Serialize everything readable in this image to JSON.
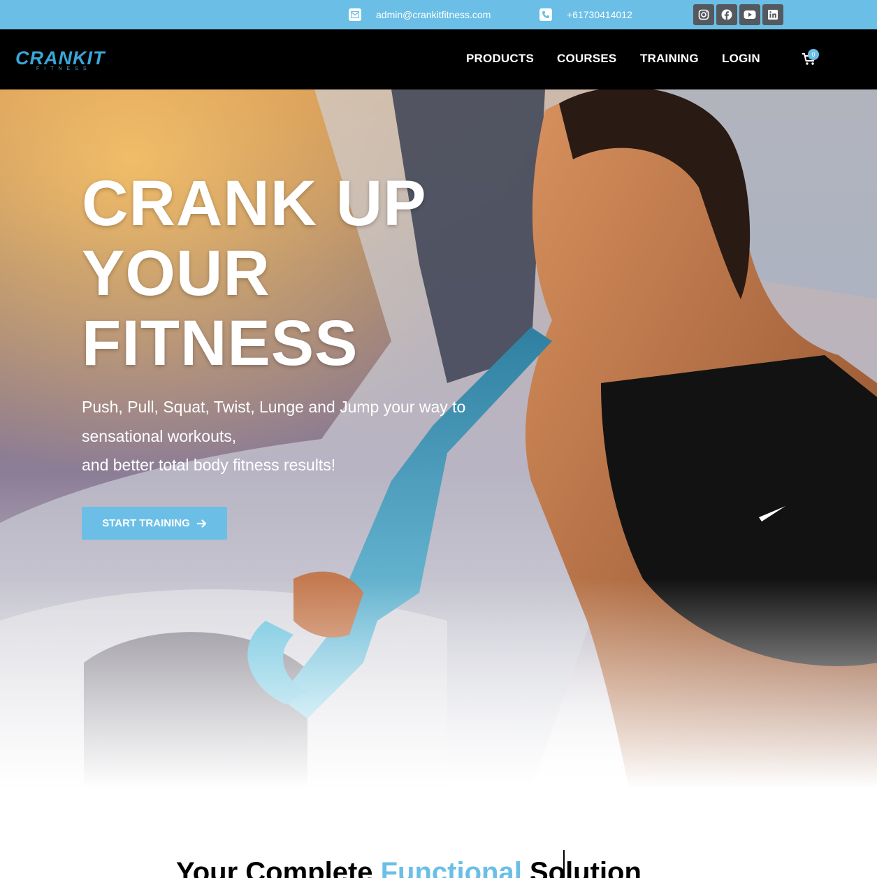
{
  "topbar": {
    "email": "admin@crankitfitness.com",
    "phone": "+61730414012",
    "email_icon": "envelope-icon",
    "phone_icon": "phone-icon",
    "socials": [
      "instagram-icon",
      "facebook-icon",
      "youtube-icon",
      "linkedin-icon"
    ]
  },
  "header": {
    "logo_text": "CRANKIT",
    "logo_sub": "FITNESS",
    "nav": [
      "PRODUCTS",
      "COURSES",
      "TRAINING",
      "LOGIN"
    ],
    "cart_count": "0",
    "cart_icon": "cart-icon"
  },
  "hero": {
    "title": [
      "CRANK UP",
      "YOUR",
      "FITNESS"
    ],
    "subtitle": [
      "Push, Pull, Squat, Twist, Lunge and Jump your way to",
      "sensational workouts,",
      "and better total body fitness results!"
    ],
    "cta_label": "START TRAINING",
    "cta_icon": "arrow-right-icon"
  },
  "section": {
    "heading_before": "Your Complete ",
    "heading_highlight": "Functional",
    "heading_after": " Solution"
  },
  "colors": {
    "accent": "#6bbfe6",
    "header_bg": "#000000",
    "social_bg": "#54595f"
  }
}
